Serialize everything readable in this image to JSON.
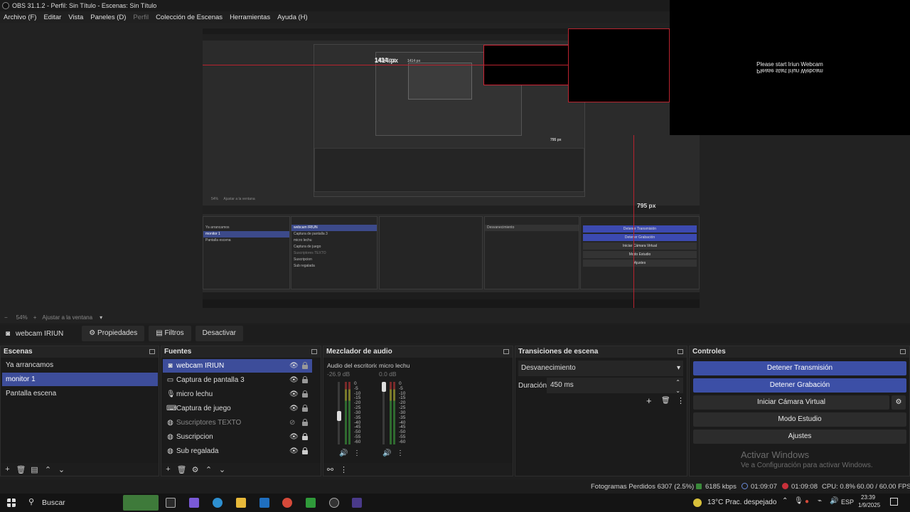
{
  "window": {
    "title": "OBS 31.1.2 - Perfil: Sin Título - Escenas: Sin Título"
  },
  "menu": [
    "Archivo (F)",
    "Editar",
    "Vista",
    "Paneles (D)",
    "Perfil",
    "Colección de Escenas",
    "Herramientas",
    "Ayuda (H)"
  ],
  "preview": {
    "measure_a": "1414 px",
    "measure_b": "795 px",
    "measure_a_small": "1414 px",
    "measure_b_small": "795 px",
    "webcam_text": "Please start Iriun Webcam",
    "nested_scale": "54%",
    "nested_fit": "Ajustar a la ventana"
  },
  "zoom": {
    "level": "54%",
    "fit_label": "Ajustar a la ventana"
  },
  "source_toolbar": {
    "current_source": "webcam IRIUN",
    "properties": "Propiedades",
    "filters": "Filtros",
    "deactivate": "Desactivar"
  },
  "scenes": {
    "title": "Escenas",
    "items": [
      "Ya arrancamos",
      "monitor 1",
      "Pantalla escena"
    ],
    "selected": 1
  },
  "sources": {
    "title": "Fuentes",
    "items": [
      {
        "label": "webcam IRIUN",
        "icon": "camera-icon",
        "visible": true,
        "locked": false
      },
      {
        "label": "Captura de pantalla 3",
        "icon": "monitor-icon",
        "visible": true,
        "locked": false
      },
      {
        "label": "micro lechu",
        "icon": "microphone-icon",
        "visible": true,
        "locked": false
      },
      {
        "label": "Captura de juego",
        "icon": "gamepad-icon",
        "visible": true,
        "locked": false
      },
      {
        "label": "Suscriptores TEXTO",
        "icon": "globe-icon",
        "visible": false,
        "locked": false
      },
      {
        "label": "Suscripcion",
        "icon": "globe-icon",
        "visible": true,
        "locked": true
      },
      {
        "label": "Sub regalada",
        "icon": "globe-icon",
        "visible": true,
        "locked": true
      }
    ]
  },
  "mixer": {
    "title": "Mezclador de audio",
    "channels": [
      {
        "name": "Audio del escritorio",
        "db": "-26.9 dB",
        "fader": 0.45
      },
      {
        "name": "micro lechu",
        "db": "0.0 dB",
        "fader": 1.0
      }
    ],
    "ticks": [
      "0",
      "-5",
      "-10",
      "-15",
      "-20",
      "-25",
      "-30",
      "-35",
      "-40",
      "-45",
      "-50",
      "-55",
      "-60"
    ]
  },
  "transitions": {
    "title": "Transiciones de escena",
    "selected": "Desvanecimiento",
    "duration_label": "Duración",
    "duration_value": "450 ms"
  },
  "controls": {
    "title": "Controles",
    "stop_stream": "Detener Transmisión",
    "stop_record": "Detener Grabación",
    "virtual_cam": "Iniciar Cámara Virtual",
    "studio_mode": "Modo Estudio",
    "settings": "Ajustes"
  },
  "watermark": {
    "line1": "Activar Windows",
    "line2": "Ve a Configuración para activar Windows."
  },
  "status": {
    "dropped_frames": "Fotogramas Perdidos 6307 (2.5%)",
    "bitrate": "6185 kbps",
    "stream_time": "01:09:07",
    "record_time": "01:09:08",
    "cpu": "CPU: 0.8%",
    "fps": "60.00 / 60.00 FPS"
  },
  "taskbar": {
    "search": "Buscar",
    "weather": "13°C  Prac. despejado",
    "lang": "ESP",
    "time": "23:39",
    "date": "1/9/2025"
  },
  "colors": {
    "accent": "#3d4d9a",
    "record_red": "#c8303a",
    "stream_blue": "#5a7ad8"
  }
}
